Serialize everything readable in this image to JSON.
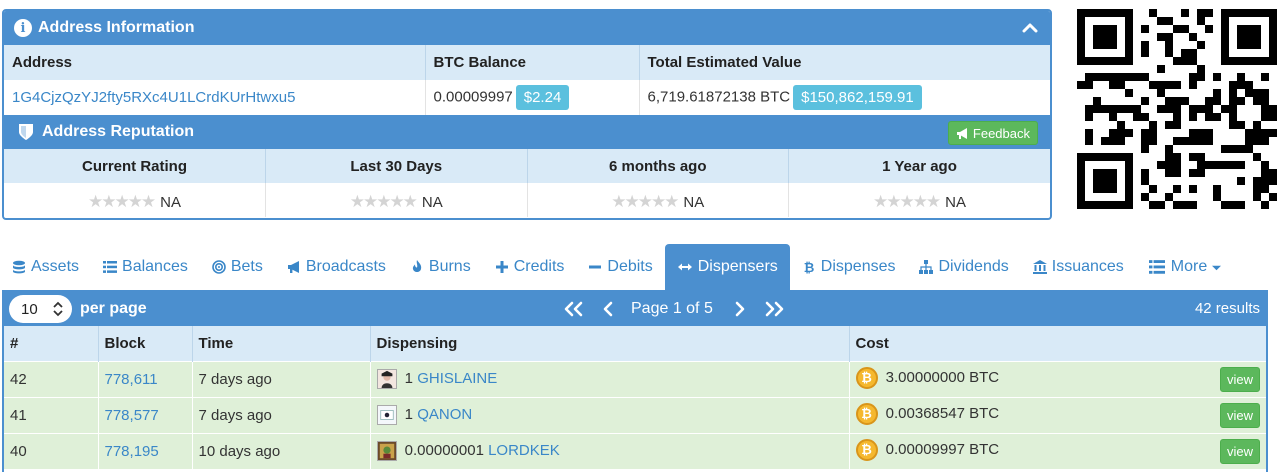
{
  "address_panel": {
    "title": "Address Information",
    "columns": [
      "Address",
      "BTC Balance",
      "Total Estimated Value"
    ],
    "address": "1G4CjzQzYJ2fty5RXc4U1LCrdKUrHtwxu5",
    "btc_balance": "0.00009997",
    "btc_balance_usd": "$2.24",
    "total_value_btc": "6,719.61872138 BTC",
    "total_value_usd": "$150,862,159.91"
  },
  "reputation_panel": {
    "title": "Address Reputation",
    "feedback_label": "Feedback",
    "columns": [
      "Current Rating",
      "Last 30 Days",
      "6 months ago",
      "1 Year ago"
    ],
    "ratings": [
      "NA",
      "NA",
      "NA",
      "NA"
    ],
    "stars": "★★★★★"
  },
  "tabs": [
    {
      "label": "Assets",
      "icon": "database-icon"
    },
    {
      "label": "Balances",
      "icon": "list-icon"
    },
    {
      "label": "Bets",
      "icon": "target-icon"
    },
    {
      "label": "Broadcasts",
      "icon": "megaphone-icon"
    },
    {
      "label": "Burns",
      "icon": "fire-icon"
    },
    {
      "label": "Credits",
      "icon": "plus-icon"
    },
    {
      "label": "Debits",
      "icon": "minus-icon"
    },
    {
      "label": "Dispensers",
      "icon": "arrows-h-icon",
      "active": true
    },
    {
      "label": "Dispenses",
      "icon": "bitcoin-icon"
    },
    {
      "label": "Dividends",
      "icon": "sitemap-icon"
    },
    {
      "label": "Issuances",
      "icon": "bank-icon"
    },
    {
      "label": "More",
      "icon": "list-icon"
    }
  ],
  "results": {
    "per_page_value": "10",
    "per_page_label": "per page",
    "page_label": "Page 1 of 5",
    "count_label": "42 results",
    "columns": [
      "#",
      "Block",
      "Time",
      "Dispensing",
      "Cost"
    ],
    "rows": [
      {
        "num": "42",
        "block": "778,611",
        "time": "7 days ago",
        "amount": "1",
        "asset": "GHISLAINE",
        "cost": "3.00000000 BTC",
        "action": "view"
      },
      {
        "num": "41",
        "block": "778,577",
        "time": "7 days ago",
        "amount": "1",
        "asset": "QANON",
        "cost": "0.00368547 BTC",
        "action": "view"
      },
      {
        "num": "40",
        "block": "778,195",
        "time": "10 days ago",
        "amount": "0.00000001",
        "asset": "LORDKEK",
        "cost": "0.00009997 BTC",
        "action": "view"
      }
    ]
  },
  "colors": {
    "primary": "#4b8fcf",
    "header_row": "#d9eaf7",
    "row_success": "#dff0d8",
    "badge_info": "#5bc0de",
    "button_success": "#5cb85c",
    "link": "#3a87c8"
  }
}
